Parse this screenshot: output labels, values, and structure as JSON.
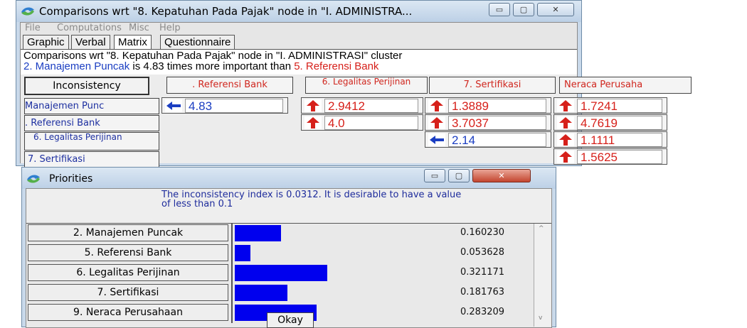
{
  "main_window": {
    "title": "Comparisons wrt \"8. Kepatuhan Pada Pajak\" node in \"I. ADMINISTRA...",
    "controls": {
      "minimize": "▭",
      "maximize": "▢",
      "close": "✕"
    },
    "menu": [
      "File",
      "Computations",
      "Misc",
      "Help"
    ],
    "tabs": [
      "Graphic",
      "Verbal",
      "Matrix",
      "Questionnaire"
    ],
    "active_tab": "Matrix",
    "info_line1": "Comparisons wrt \"8. Kepatuhan Pada Pajak\" node in \"I. ADMINISTRASI\" cluster",
    "info_line2": {
      "part1": "2. Manajemen Puncak",
      "part2": " is 4.83 times more important than ",
      "part3": "5. Referensi Bank"
    },
    "inconsistency_button": "Inconsistency",
    "column_headers": [
      ". Referensi Bank",
      "6. Legalitas Perijinan",
      "7. Sertifikasi",
      "Neraca Perusaha"
    ],
    "row_headers": [
      "Manajemen Punc",
      ". Referensi Bank",
      "6. Legalitas Perijinan",
      "7. Sertifikasi"
    ],
    "cells": [
      {
        "row": 0,
        "col": 0,
        "value": "4.83",
        "arrow": "left",
        "color": "blue"
      },
      {
        "row": 0,
        "col": 1,
        "value": "2.9412",
        "arrow": "up",
        "color": "red"
      },
      {
        "row": 0,
        "col": 2,
        "value": "1.3889",
        "arrow": "up",
        "color": "red"
      },
      {
        "row": 0,
        "col": 3,
        "value": "1.7241",
        "arrow": "up",
        "color": "red"
      },
      {
        "row": 1,
        "col": 1,
        "value": "4.0",
        "arrow": "up",
        "color": "red"
      },
      {
        "row": 1,
        "col": 2,
        "value": "3.7037",
        "arrow": "up",
        "color": "red"
      },
      {
        "row": 1,
        "col": 3,
        "value": "4.7619",
        "arrow": "up",
        "color": "red"
      },
      {
        "row": 2,
        "col": 2,
        "value": "2.14",
        "arrow": "left",
        "color": "blue"
      },
      {
        "row": 2,
        "col": 3,
        "value": "1.1111",
        "arrow": "up",
        "color": "red"
      },
      {
        "row": 3,
        "col": 3,
        "value": "1.5625",
        "arrow": "up",
        "color": "red"
      }
    ]
  },
  "priorities_window": {
    "title": "Priorities",
    "inconsistency_message": "The inconsistency index is 0.0312.  It is desirable to have a value of less than 0.1",
    "items": [
      {
        "label": "2. Manajemen Puncak",
        "value": "0.160230",
        "weight": 0.16023
      },
      {
        "label": "5. Referensi Bank",
        "value": "0.053628",
        "weight": 0.053628
      },
      {
        "label": "6. Legalitas Perijinan",
        "value": "0.321171",
        "weight": 0.321171
      },
      {
        "label": "7. Sertifikasi",
        "value": "0.181763",
        "weight": 0.181763
      },
      {
        "label": "9. Neraca Perusahaan",
        "value": "0.283209",
        "weight": 0.283209
      }
    ],
    "okay_button": "Okay"
  },
  "colors": {
    "red": "#d6201a",
    "blue": "#1b3ec2",
    "bar": "#0000ee"
  }
}
